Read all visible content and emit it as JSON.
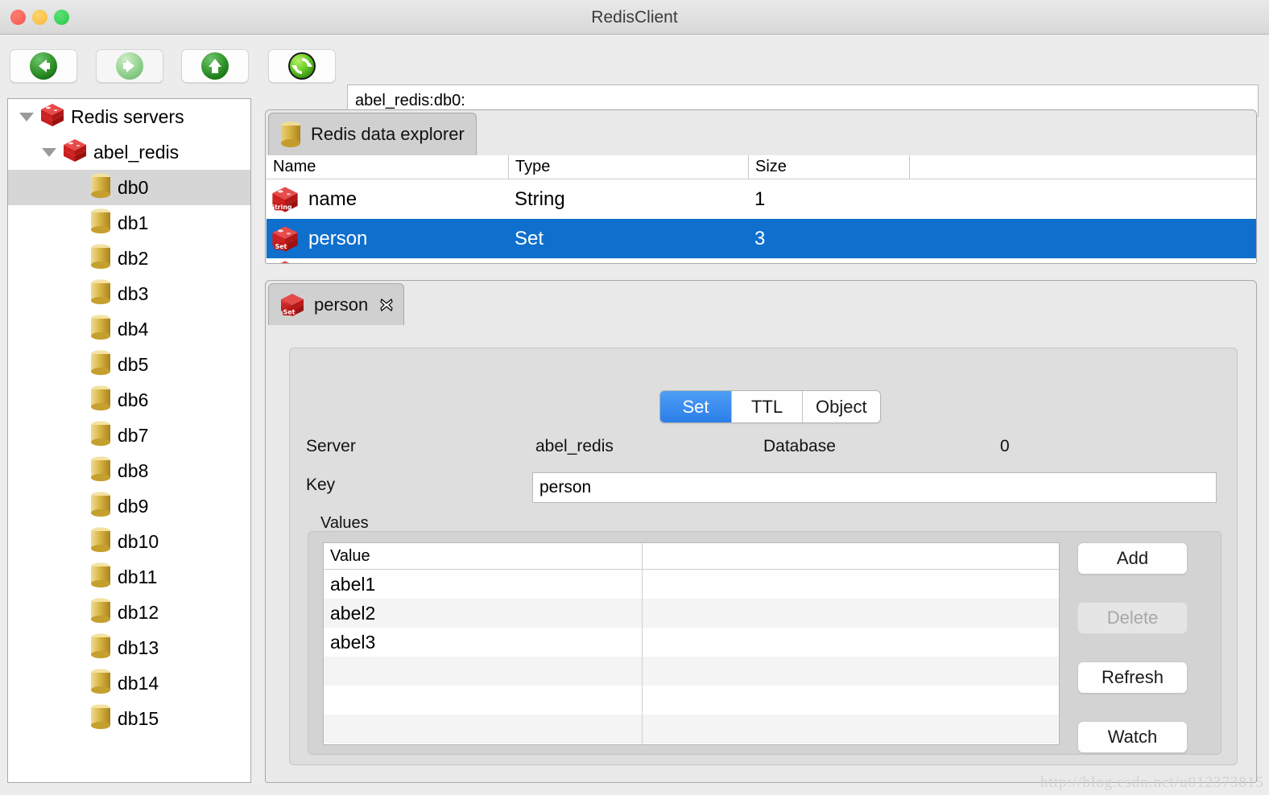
{
  "window": {
    "title": "RedisClient",
    "traffic_lights": [
      "close",
      "minimize",
      "zoom"
    ]
  },
  "toolbar": {
    "buttons": [
      {
        "name": "back",
        "icon": "arrow-left-icon",
        "enabled": true
      },
      {
        "name": "forward",
        "icon": "arrow-right-icon",
        "enabled": false
      },
      {
        "name": "up",
        "icon": "arrow-up-icon",
        "enabled": true
      },
      {
        "name": "refresh",
        "icon": "refresh-icon",
        "enabled": true
      }
    ],
    "address": "abel_redis:db0:"
  },
  "sidebar": {
    "items": [
      {
        "label": "Redis servers",
        "icon": "redis-cube-icon",
        "depth": 0,
        "expander": "triangle-down",
        "selected": false
      },
      {
        "label": "abel_redis",
        "icon": "redis-cube-icon",
        "depth": 1,
        "expander": "triangle-down",
        "selected": false
      },
      {
        "label": "db0",
        "icon": "database-icon",
        "depth": 2,
        "expander": "none",
        "selected": true
      },
      {
        "label": "db1",
        "icon": "database-icon",
        "depth": 2,
        "expander": "none",
        "selected": false
      },
      {
        "label": "db2",
        "icon": "database-icon",
        "depth": 2,
        "expander": "none",
        "selected": false
      },
      {
        "label": "db3",
        "icon": "database-icon",
        "depth": 2,
        "expander": "none",
        "selected": false
      },
      {
        "label": "db4",
        "icon": "database-icon",
        "depth": 2,
        "expander": "none",
        "selected": false
      },
      {
        "label": "db5",
        "icon": "database-icon",
        "depth": 2,
        "expander": "none",
        "selected": false
      },
      {
        "label": "db6",
        "icon": "database-icon",
        "depth": 2,
        "expander": "none",
        "selected": false
      },
      {
        "label": "db7",
        "icon": "database-icon",
        "depth": 2,
        "expander": "none",
        "selected": false
      },
      {
        "label": "db8",
        "icon": "database-icon",
        "depth": 2,
        "expander": "none",
        "selected": false
      },
      {
        "label": "db9",
        "icon": "database-icon",
        "depth": 2,
        "expander": "none",
        "selected": false
      },
      {
        "label": "db10",
        "icon": "database-icon",
        "depth": 2,
        "expander": "none",
        "selected": false
      },
      {
        "label": "db11",
        "icon": "database-icon",
        "depth": 2,
        "expander": "none",
        "selected": false
      },
      {
        "label": "db12",
        "icon": "database-icon",
        "depth": 2,
        "expander": "none",
        "selected": false
      },
      {
        "label": "db13",
        "icon": "database-icon",
        "depth": 2,
        "expander": "none",
        "selected": false
      },
      {
        "label": "db14",
        "icon": "database-icon",
        "depth": 2,
        "expander": "none",
        "selected": false
      },
      {
        "label": "db15",
        "icon": "database-icon",
        "depth": 2,
        "expander": "none",
        "selected": false
      }
    ]
  },
  "explorer": {
    "tab_label": "Redis data explorer",
    "tab_icon": "database-icon",
    "columns": [
      "Name",
      "Type",
      "Size"
    ],
    "rows": [
      {
        "name": "name",
        "type": "String",
        "size": "1",
        "icon": "redis-string-icon",
        "selected": false
      },
      {
        "name": "person",
        "type": "Set",
        "size": "3",
        "icon": "redis-set-icon",
        "selected": true
      }
    ]
  },
  "detail": {
    "tab_label": "person",
    "tab_icon": "redis-set-icon",
    "close_icon": "close-icon",
    "segments": [
      {
        "label": "Set",
        "active": true
      },
      {
        "label": "TTL",
        "active": false
      },
      {
        "label": "Object",
        "active": false
      }
    ],
    "fields": {
      "server_label": "Server",
      "server_value": "abel_redis",
      "database_label": "Database",
      "database_value": "0",
      "key_label": "Key",
      "key_value": "person"
    },
    "values_group_label": "Values",
    "values_column": "Value",
    "values": [
      "abel1",
      "abel2",
      "abel3"
    ],
    "buttons": [
      {
        "label": "Add",
        "enabled": true
      },
      {
        "label": "Delete",
        "enabled": false
      },
      {
        "label": "Refresh",
        "enabled": true
      },
      {
        "label": "Watch",
        "enabled": true
      }
    ]
  },
  "watermark": "http://blog.csdn.net/u012373815",
  "colors": {
    "selection_blue": "#0f6fcd",
    "segment_active_blue": "#2b7ee8",
    "tree_selection_gray": "#d6d6d6",
    "redis_red": "#cf2020",
    "db_gold": "#d9ac3c",
    "window_chrome": "#ececec"
  }
}
